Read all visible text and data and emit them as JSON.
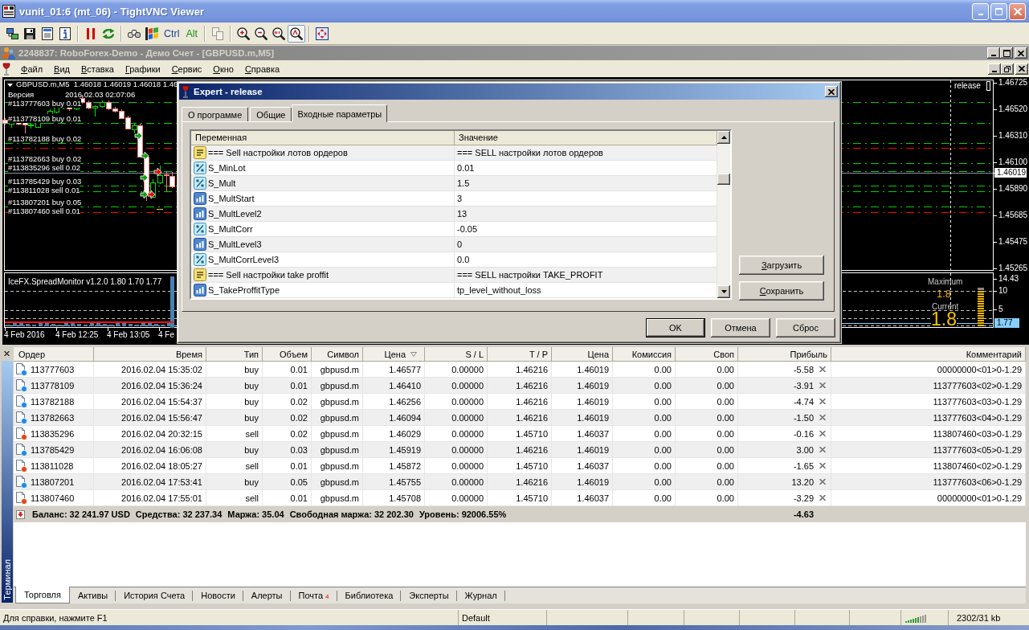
{
  "vnc_window": {
    "title": "vunit_01:6 (mt_06) - TightVNC Viewer"
  },
  "toolbar": [
    {
      "kind": "connection",
      "selected": false,
      "disabled": false
    },
    {
      "kind": "save",
      "selected": false,
      "disabled": false
    },
    {
      "kind": "properties",
      "selected": false,
      "disabled": false
    },
    {
      "kind": "info",
      "selected": false,
      "disabled": false
    },
    {
      "kind": "separator"
    },
    {
      "kind": "pause",
      "selected": false,
      "disabled": false
    },
    {
      "kind": "refresh",
      "selected": false,
      "disabled": false
    },
    {
      "kind": "separator"
    },
    {
      "kind": "keys",
      "selected": false,
      "disabled": false
    },
    {
      "kind": "winkey",
      "selected": false,
      "disabled": false
    },
    {
      "kind": "text",
      "label": "Ctrl",
      "color": "#1f3f9f",
      "selected": false,
      "disabled": false
    },
    {
      "kind": "text",
      "label": "Alt",
      "color": "#1e8c1e",
      "selected": false,
      "disabled": false
    },
    {
      "kind": "separator"
    },
    {
      "kind": "copy",
      "selected": false,
      "disabled": true
    },
    {
      "kind": "separator"
    },
    {
      "kind": "zoomin",
      "selected": false,
      "disabled": false
    },
    {
      "kind": "zoomout",
      "selected": false,
      "disabled": false
    },
    {
      "kind": "zoomreset",
      "selected": false,
      "disabled": false
    },
    {
      "kind": "zoomfit",
      "selected": true,
      "disabled": false
    },
    {
      "kind": "separator"
    },
    {
      "kind": "fullscreen",
      "selected": false,
      "disabled": false
    }
  ],
  "terminal_window": {
    "title": "2248837: RoboForex-Demo - Демо Счет - [GBPUSD.m,M5]"
  },
  "menu": [
    "Файл",
    "Вид",
    "Вставка",
    "Графики",
    "Сервис",
    "Окно",
    "Справка"
  ],
  "chart": {
    "header": "GBPUSD.m,M5  1.46018 1.46019 1.46018 1.46",
    "comment": [
      "Версия",
      "2016.02.03 02:07:06"
    ],
    "order_labels": [
      "#113777603 buy 0.01",
      "#113778109 buy 0.01",
      "#113782188 buy 0.02",
      "#113782663 buy 0.02",
      "#113835296 sell 0.02",
      "#113785429 buy 0.03",
      "#113811028 sell 0.01",
      "#113807201 buy 0.05",
      "#113807460 sell 0.01"
    ],
    "expert": "release",
    "price_scale": [
      "1.46725",
      "1.46520",
      "1.46310",
      "1.46100",
      "1.45890",
      "1.45685",
      "1.45475",
      "1.45265"
    ],
    "current_price": "1.46019",
    "time_scale": [
      "4 Feb 2016",
      "4 Feb 12:25",
      "4 Feb 13:05",
      "4 Fe"
    ],
    "indicator": {
      "title": "IceFX.SpreadMonitor v1.2.0 1.80 1.70 1.77",
      "maximum_label": "Maximum",
      "maximum_value": "1.8",
      "current_label": "Current",
      "current_value": "1.8",
      "scale": [
        "14.43",
        "10",
        "5"
      ],
      "current_reading": "1.77"
    }
  },
  "dialog": {
    "title": "Expert - release",
    "tabs": [
      {
        "label": "О программе",
        "selected": false
      },
      {
        "label": "Общие",
        "selected": false
      },
      {
        "label": "Входные параметры",
        "selected": true
      }
    ],
    "columns": [
      "Переменная",
      "Значение"
    ],
    "rows": [
      {
        "kind": "string",
        "name": "=== Sell настройки лотов ордеров",
        "value": "=== SELL настройки лотов ордеров"
      },
      {
        "kind": "double",
        "name": "S_MinLot",
        "value": "0.01"
      },
      {
        "kind": "double",
        "name": "S_Mult",
        "value": "1.5"
      },
      {
        "kind": "int",
        "name": "S_MultStart",
        "value": "3"
      },
      {
        "kind": "int",
        "name": "S_MultLevel2",
        "value": "13"
      },
      {
        "kind": "double",
        "name": "S_MultCorr",
        "value": "-0.05"
      },
      {
        "kind": "int",
        "name": "S_MultLevel3",
        "value": "0"
      },
      {
        "kind": "double",
        "name": "S_MultCorrLevel3",
        "value": "0.0"
      },
      {
        "kind": "string",
        "name": "=== Sell настройки take proffit",
        "value": "=== SELL настройки TAKE_PROFIT"
      },
      {
        "kind": "int",
        "name": "S_TakeProffitType",
        "value": "tp_level_without_loss"
      }
    ],
    "side_buttons": [
      "Загрузить",
      "Сохранить"
    ],
    "buttons": [
      {
        "label": "OK",
        "default": true
      },
      {
        "label": "Отмена",
        "default": false
      },
      {
        "label": "Сброс",
        "default": false
      }
    ]
  },
  "terminal": {
    "title": "Терминал",
    "columns": [
      {
        "label": "Ордер",
        "sorted": false
      },
      {
        "label": "Время",
        "sorted": false
      },
      {
        "label": "Тип",
        "sorted": false
      },
      {
        "label": "Объем",
        "sorted": false
      },
      {
        "label": "Символ",
        "sorted": false
      },
      {
        "label": "Цена",
        "sorted": true
      },
      {
        "label": "S / L",
        "sorted": false
      },
      {
        "label": "T / P",
        "sorted": false
      },
      {
        "label": "Цена",
        "sorted": false
      },
      {
        "label": "Комиссия",
        "sorted": false
      },
      {
        "label": "Своп",
        "sorted": false
      },
      {
        "label": "Прибыль",
        "sorted": false
      },
      {
        "label": "Комментарий",
        "sorted": false
      }
    ],
    "rows": [
      {
        "kind": "buy",
        "cells": [
          "113777603",
          "2016.02.04 15:35:02",
          "buy",
          "0.01",
          "gbpusd.m",
          "1.46577",
          "0.00000",
          "1.46216",
          "1.46019",
          "0.00",
          "0.00",
          "-5.58",
          "00000000<01>0-1.29"
        ]
      },
      {
        "kind": "buy",
        "cells": [
          "113778109",
          "2016.02.04 15:36:24",
          "buy",
          "0.01",
          "gbpusd.m",
          "1.46410",
          "0.00000",
          "1.46216",
          "1.46019",
          "0.00",
          "0.00",
          "-3.91",
          "113777603<02>0-1.29"
        ]
      },
      {
        "kind": "buy",
        "cells": [
          "113782188",
          "2016.02.04 15:54:37",
          "buy",
          "0.02",
          "gbpusd.m",
          "1.46256",
          "0.00000",
          "1.46216",
          "1.46019",
          "0.00",
          "0.00",
          "-4.74",
          "113777603<03>0-1.29"
        ]
      },
      {
        "kind": "buy",
        "cells": [
          "113782663",
          "2016.02.04 15:56:47",
          "buy",
          "0.02",
          "gbpusd.m",
          "1.46094",
          "0.00000",
          "1.46216",
          "1.46019",
          "0.00",
          "0.00",
          "-1.50",
          "113777603<04>0-1.29"
        ]
      },
      {
        "kind": "sell",
        "cells": [
          "113835296",
          "2016.02.04 20:32:15",
          "sell",
          "0.02",
          "gbpusd.m",
          "1.46029",
          "0.00000",
          "1.45710",
          "1.46037",
          "0.00",
          "0.00",
          "-0.16",
          "113807460<03>0-1.29"
        ]
      },
      {
        "kind": "buy",
        "cells": [
          "113785429",
          "2016.02.04 16:06:08",
          "buy",
          "0.03",
          "gbpusd.m",
          "1.45919",
          "0.00000",
          "1.46216",
          "1.46019",
          "0.00",
          "0.00",
          "3.00",
          "113777603<05>0-1.29"
        ]
      },
      {
        "kind": "sell",
        "cells": [
          "113811028",
          "2016.02.04 18:05:27",
          "sell",
          "0.01",
          "gbpusd.m",
          "1.45872",
          "0.00000",
          "1.45710",
          "1.46037",
          "0.00",
          "0.00",
          "-1.65",
          "113807460<02>0-1.29"
        ]
      },
      {
        "kind": "buy",
        "cells": [
          "113807201",
          "2016.02.04 17:53:41",
          "buy",
          "0.05",
          "gbpusd.m",
          "1.45755",
          "0.00000",
          "1.46216",
          "1.46019",
          "0.00",
          "0.00",
          "13.20",
          "113777603<06>0-1.29"
        ]
      },
      {
        "kind": "sell",
        "cells": [
          "113807460",
          "2016.02.04 17:55:01",
          "sell",
          "0.01",
          "gbpusd.m",
          "1.45708",
          "0.00000",
          "1.45710",
          "1.46037",
          "0.00",
          "0.00",
          "-3.29",
          "00000000<01>0-1.29"
        ]
      }
    ],
    "summary": {
      "items": [
        "Баланс: 32 241.97 USD",
        "Средства: 32 237.34",
        "Маржа: 35.04",
        "Свободная маржа: 32 202.30",
        "Уровень: 92006.55%"
      ],
      "profit": "-4.63"
    },
    "tabs": [
      {
        "label": "Торговля",
        "selected": true
      },
      {
        "label": "Активы",
        "selected": false
      },
      {
        "label": "История Счета",
        "selected": false
      },
      {
        "label": "Новости",
        "selected": false
      },
      {
        "label": "Алерты",
        "selected": false
      },
      {
        "label": "Почта",
        "badge": "4",
        "selected": false
      },
      {
        "label": "Библиотека",
        "selected": false
      },
      {
        "label": "Эксперты",
        "selected": false
      },
      {
        "label": "Журнал",
        "selected": false
      }
    ]
  },
  "status_bar": {
    "help": "Для справки, нажмите F1",
    "profile": "Default",
    "traffic": "2302/31 kb"
  }
}
